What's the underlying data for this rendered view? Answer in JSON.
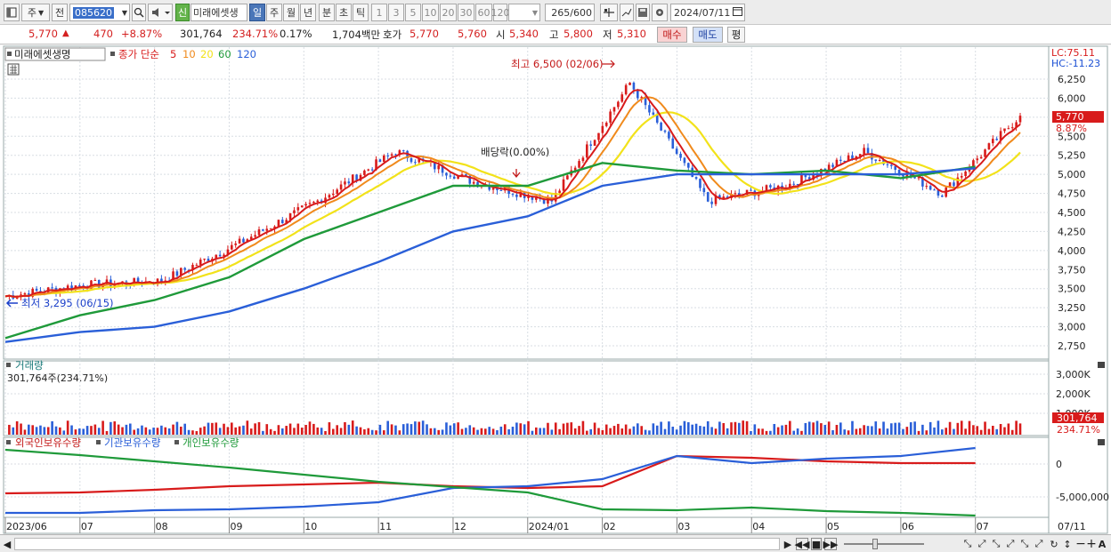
{
  "toolbar": {
    "market_tab": "주",
    "type_tab": "전",
    "stock_code": "085620",
    "badge_new": "신",
    "stock_name": "미래에셋생",
    "periods": [
      "일",
      "주",
      "월",
      "년",
      "분",
      "초",
      "틱"
    ],
    "active_period": "일",
    "minute_options": [
      "1",
      "3",
      "5",
      "10",
      "20",
      "30",
      "60",
      "120"
    ],
    "count": "265",
    "max_count": "/600",
    "date": "2024/07/11"
  },
  "quote": {
    "price": "5,770",
    "change_arrow": "▲",
    "change": "470",
    "change_pct": "+8.87%",
    "volume": "301,764",
    "volume_ratio": "234.71%",
    "turnover": "0.17%",
    "amount": "1,704백만",
    "hoga_label": "호가",
    "ask": "5,770",
    "bid": "5,760",
    "open_label": "시",
    "open": "5,340",
    "high_label": "고",
    "high": "5,800",
    "low_label": "저",
    "low": "5,310",
    "buy_btn": "매수",
    "sell_btn": "매도",
    "eval_btn": "평"
  },
  "chart": {
    "stock_title": "미래에셋생명",
    "ma_label": "종가 단순",
    "ma_periods": [
      "5",
      "10",
      "20",
      "60",
      "120"
    ],
    "ma_colors": [
      "#d81b1b",
      "#f08a1c",
      "#f2e21a",
      "#1f9a3a",
      "#2a5fd8"
    ],
    "lc_label": "LC:75.11",
    "hc_label": "HC:-11.23",
    "price_axis": [
      "6,250",
      "6,000",
      "5,750",
      "5,500",
      "5,250",
      "5,000",
      "4,750",
      "4,500",
      "4,250",
      "4,000",
      "3,750",
      "3,500",
      "3,250",
      "3,000",
      "2,750"
    ],
    "current_price_tag": "5,770",
    "current_pct_tag": "8.87%",
    "high_annotation": "최고 6,500 (02/06)",
    "low_annotation": "최저 3,295 (06/15)",
    "dividend_annotation": "배당락(0.00%)",
    "volume_title": "거래량",
    "volume_info": "301,764주(234.71%)",
    "volume_axis": [
      "3,000K",
      "2,000K",
      "1,000K"
    ],
    "volume_tag": "301,764",
    "volume_pct_tag": "234.71%",
    "holdings_legend": [
      "외국인보유수량",
      "기관보유수량",
      "개인보유수량"
    ],
    "holdings_colors": [
      "#d81b1b",
      "#2a5fd8",
      "#1f9a3a"
    ],
    "holdings_axis": [
      "0",
      "-5,000,000"
    ],
    "x_axis": [
      "2023/06",
      "07",
      "08",
      "09",
      "10",
      "11",
      "12",
      "2024/01",
      "02",
      "03",
      "04",
      "05",
      "06",
      "07"
    ],
    "x_axis_last": "07/11"
  },
  "chart_data": {
    "type": "line",
    "title": "미래에셋생명",
    "x": [
      "2023/06",
      "2023/07",
      "2023/08",
      "2023/09",
      "2023/10",
      "2023/11",
      "2023/12",
      "2024/01",
      "2024/02",
      "2024/03",
      "2024/04",
      "2024/05",
      "2024/06",
      "2024/07"
    ],
    "series": [
      {
        "name": "종가",
        "values": [
          3400,
          3550,
          3600,
          4100,
          4650,
          5300,
          4900,
          4650,
          6200,
          4650,
          4850,
          5300,
          4750,
          5770
        ]
      },
      {
        "name": "60",
        "values": [
          2850,
          3150,
          3350,
          3650,
          4150,
          4500,
          4850,
          4850,
          5150,
          5050,
          5000,
          5050,
          4950,
          5100
        ]
      },
      {
        "name": "120",
        "values": [
          2800,
          2930,
          3000,
          3200,
          3500,
          3850,
          4250,
          4450,
          4850,
          5000,
          5000,
          5000,
          5000,
          5080
        ]
      }
    ],
    "ylim": [
      2750,
      6250
    ],
    "annotations": [
      {
        "label": "최고 6,500 (02/06)",
        "value": 6500
      },
      {
        "label": "최저 3,295 (06/15)",
        "value": 3295
      },
      {
        "label": "배당락(0.00%)"
      }
    ]
  }
}
